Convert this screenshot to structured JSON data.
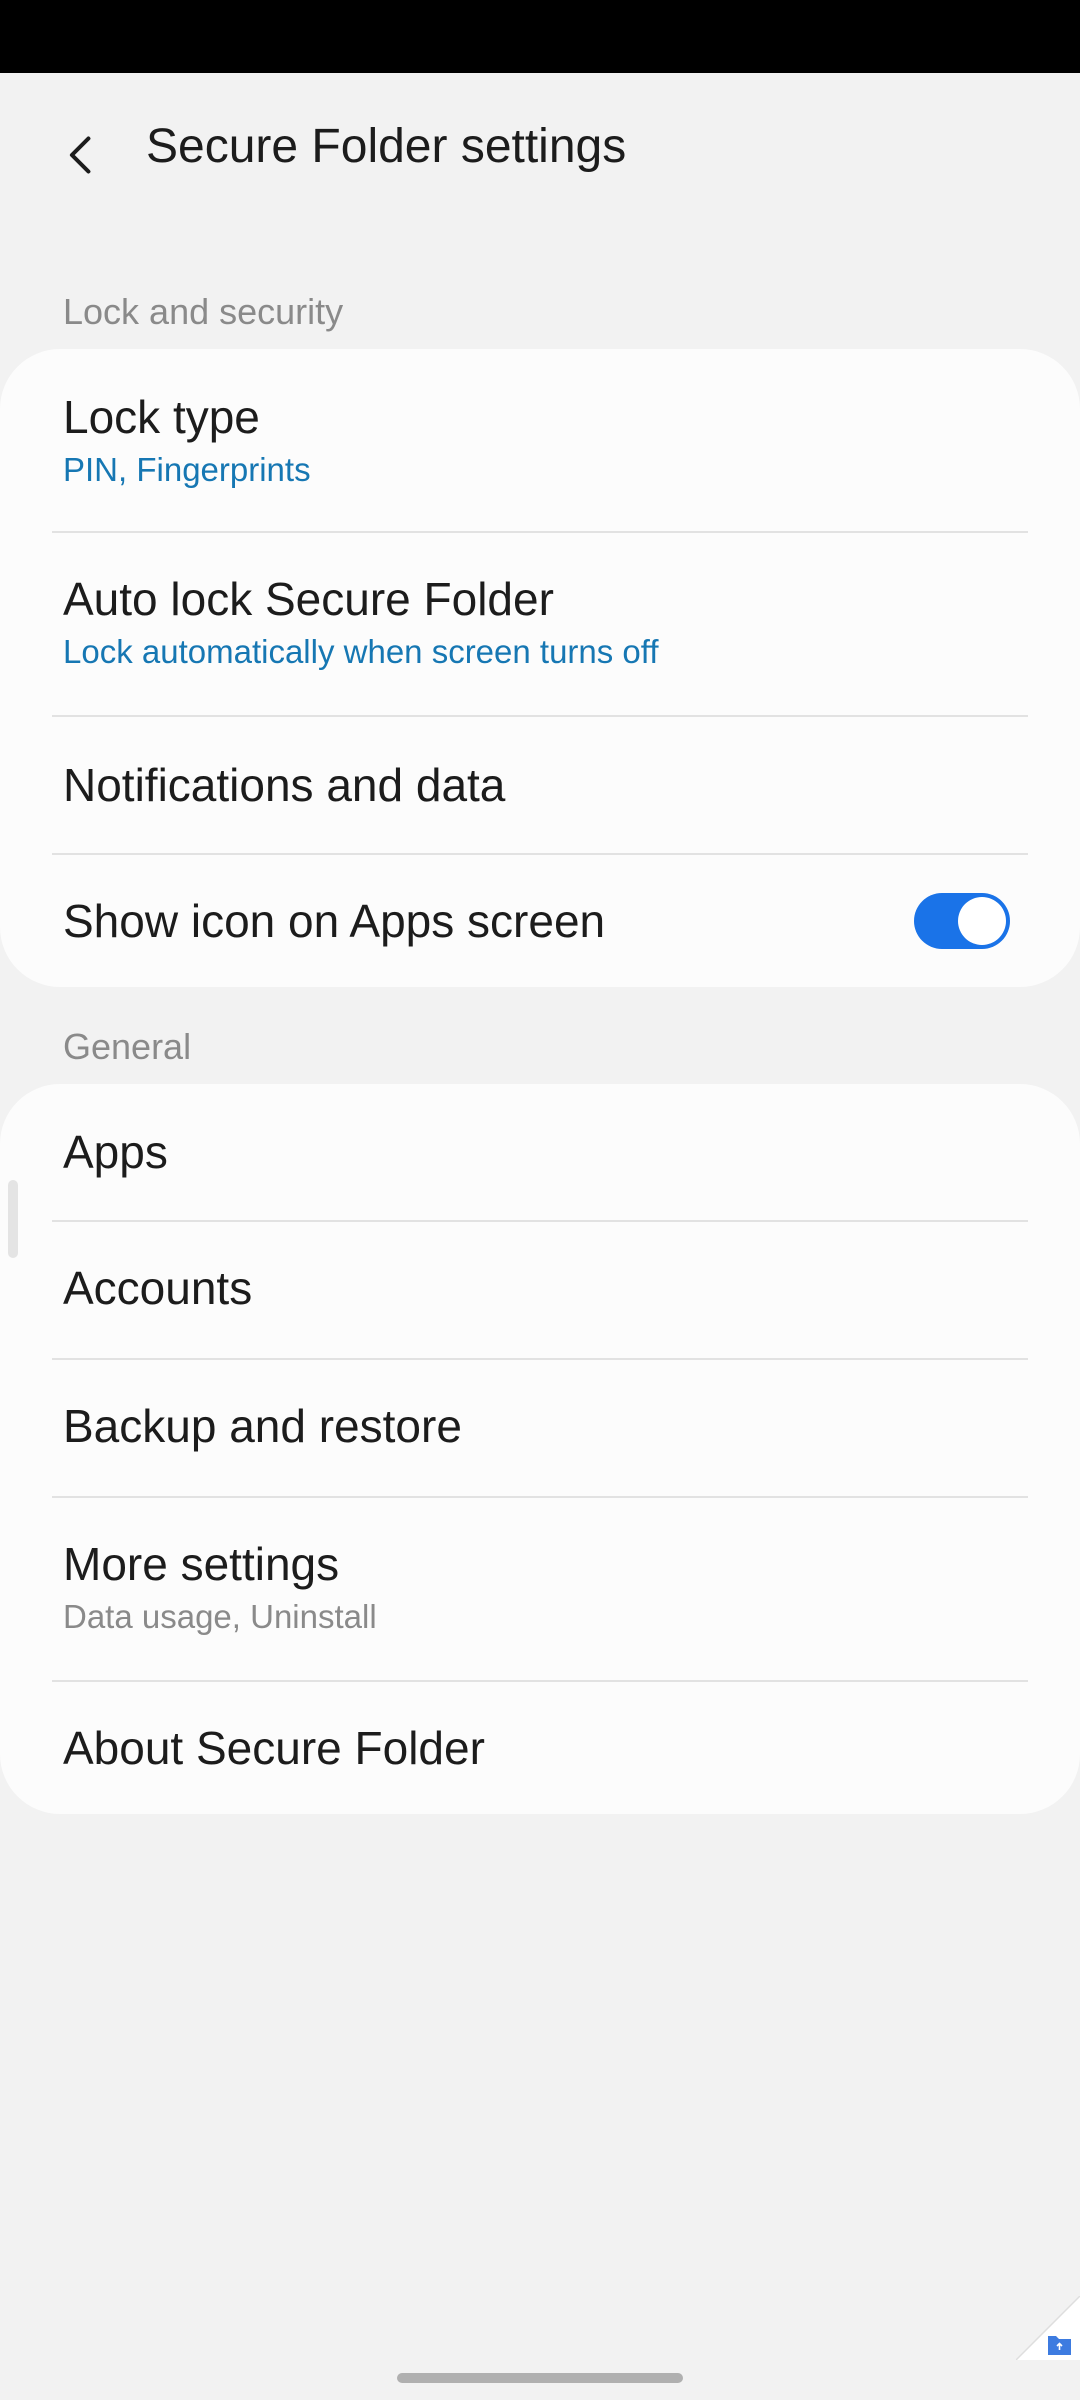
{
  "header": {
    "title": "Secure Folder settings"
  },
  "sections": [
    {
      "title": "Lock and security",
      "items": [
        {
          "title": "Lock type",
          "subtitle": "PIN, Fingerprints"
        },
        {
          "title": "Auto lock Secure Folder",
          "subtitle": "Lock automatically when screen turns off"
        },
        {
          "title": "Notifications and data"
        },
        {
          "title": "Show icon on Apps screen",
          "toggle": true
        }
      ]
    },
    {
      "title": "General",
      "items": [
        {
          "title": "Apps"
        },
        {
          "title": "Accounts"
        },
        {
          "title": "Backup and restore"
        },
        {
          "title": "More settings",
          "subtitle": "Data usage, Uninstall"
        },
        {
          "title": "About Secure Folder"
        }
      ]
    }
  ],
  "colors": {
    "accent": "#1a73e8",
    "subtitle_blue": "#1677b3",
    "background": "#f2f2f2",
    "card": "#fcfcfc"
  },
  "icons": {
    "back": "chevron-left-icon",
    "corner": "folder-icon"
  }
}
